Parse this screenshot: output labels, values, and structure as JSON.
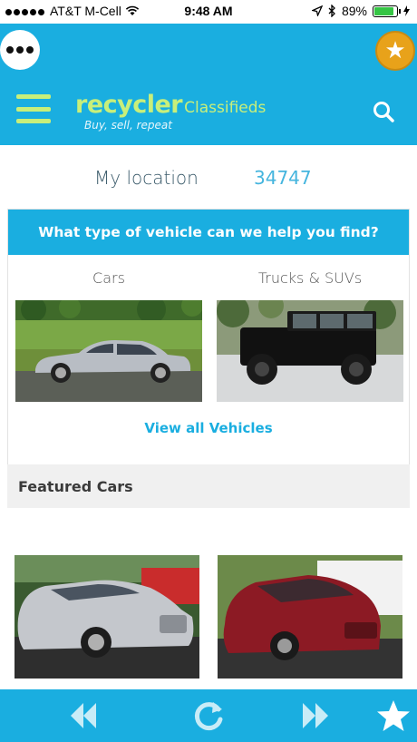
{
  "status": {
    "carrier": "AT&T M-Cell",
    "time": "9:48 AM",
    "battery": "89%"
  },
  "header": {
    "brand": "recycler",
    "brand_sub": "Classifieds",
    "tagline": "Buy, sell, repeat"
  },
  "location": {
    "label": "My location",
    "zip": "34747"
  },
  "finder": {
    "title": "What type of vehicle can we help you find?",
    "types": [
      {
        "label": "Cars"
      },
      {
        "label": "Trucks & SUVs"
      }
    ],
    "view_all": "View all Vehicles"
  },
  "featured": {
    "title": "Featured Cars"
  },
  "colors": {
    "accent": "#1aaee0",
    "brand_green": "#c8ef7a",
    "star_gold": "#e8a21a"
  },
  "icons": {
    "more": "more-icon",
    "favorite": "star-icon",
    "menu": "hamburger-icon",
    "search": "search-icon",
    "back": "rewind-icon",
    "reload": "reload-icon",
    "forward": "fast-forward-icon",
    "bookmark": "star-icon"
  }
}
